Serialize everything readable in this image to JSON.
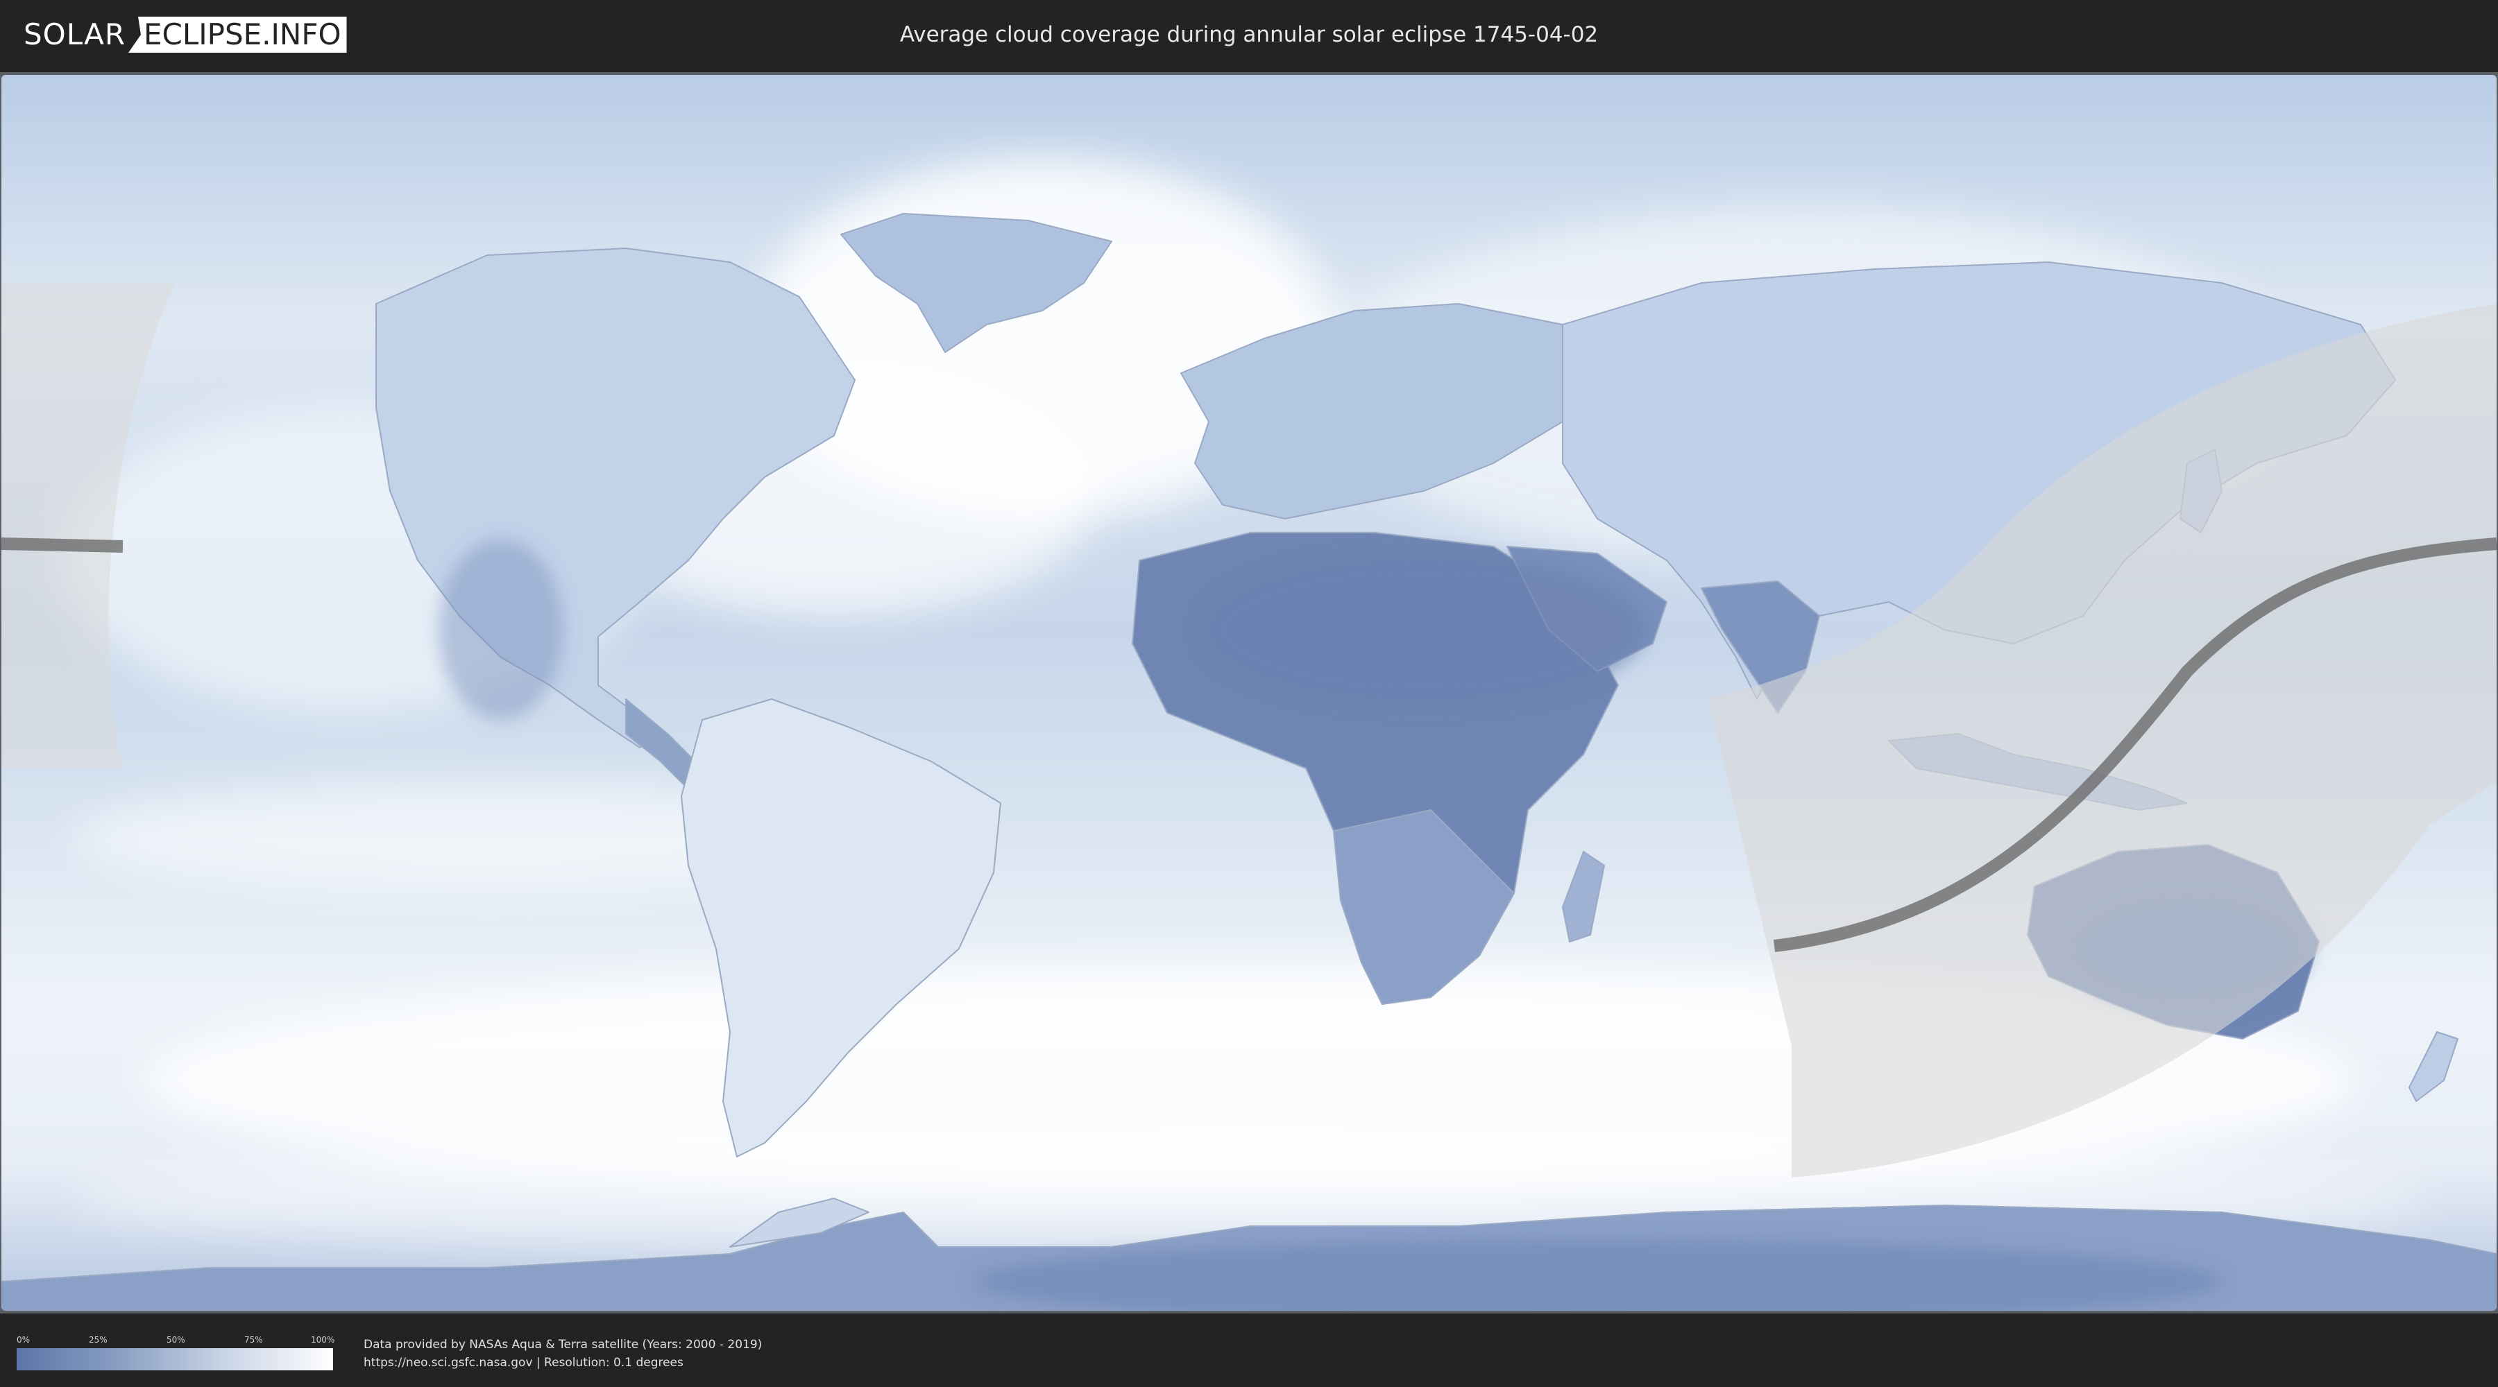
{
  "header": {
    "logo_left": "SOLAR",
    "logo_right": "ECLIPSE.INFO",
    "title": "Average cloud coverage during annular solar eclipse 1745-04-02"
  },
  "map": {
    "type": "cloud-coverage-world-map",
    "colors": {
      "ocean_base": "#c9d7ea",
      "cloud_dense": "#f4f7fb",
      "clear_sky": "#6f86b4",
      "eclipse_zone": "#d9d9d9",
      "eclipse_path": "#6b6b6b"
    }
  },
  "legend": {
    "ticks": [
      "0%",
      "25%",
      "50%",
      "75%",
      "100%"
    ]
  },
  "footer": {
    "source_line": "Data provided by NASAs Aqua & Terra satellite (Years: 2000 - 2019)",
    "url_line": "https://neo.sci.gsfc.nasa.gov | Resolution: 0.1 degrees"
  }
}
